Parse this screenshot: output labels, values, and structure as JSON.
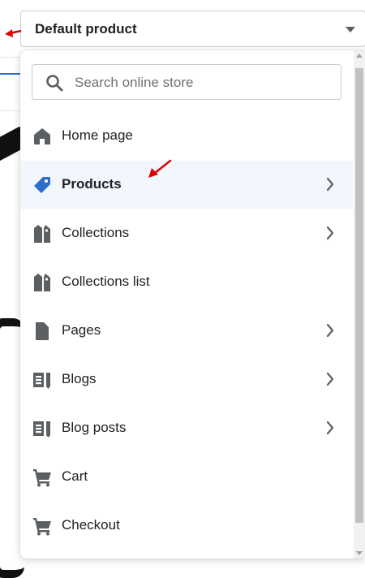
{
  "selector": {
    "label": "Default product"
  },
  "search": {
    "placeholder": "Search online store"
  },
  "menu": [
    {
      "label": "Home page",
      "icon": "home-icon",
      "has_submenu": false
    },
    {
      "label": "Products",
      "icon": "tag-icon",
      "has_submenu": true,
      "active": true
    },
    {
      "label": "Collections",
      "icon": "collections-icon",
      "has_submenu": true
    },
    {
      "label": "Collections list",
      "icon": "collections-icon",
      "has_submenu": false
    },
    {
      "label": "Pages",
      "icon": "page-icon",
      "has_submenu": true
    },
    {
      "label": "Blogs",
      "icon": "blog-icon",
      "has_submenu": true
    },
    {
      "label": "Blog posts",
      "icon": "blog-icon",
      "has_submenu": true
    },
    {
      "label": "Cart",
      "icon": "cart-icon",
      "has_submenu": false
    },
    {
      "label": "Checkout",
      "icon": "cart-icon",
      "has_submenu": false
    }
  ],
  "colors": {
    "accent_blue": "#2c6ecb",
    "icon_gray": "#5c5f62",
    "active_bg": "#f2f7fe",
    "annotation_red": "#e00000"
  }
}
